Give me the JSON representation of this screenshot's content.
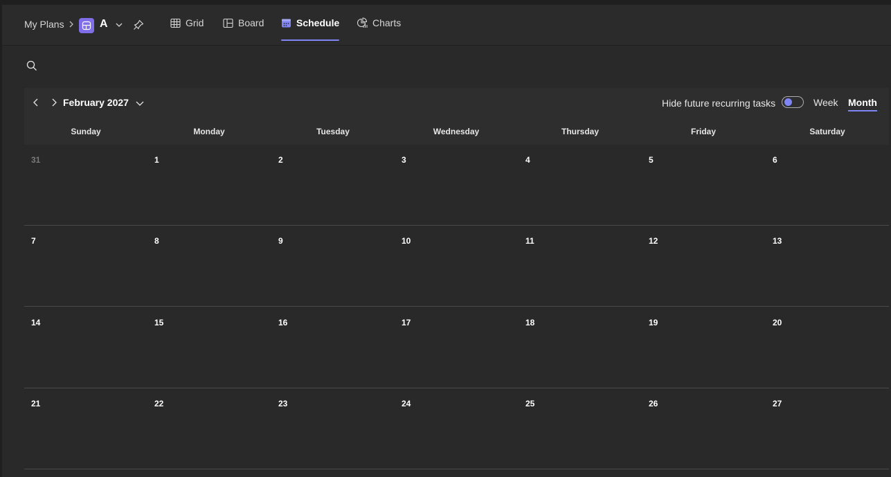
{
  "breadcrumb": {
    "root": "My Plans",
    "plan_name": "A"
  },
  "tabs": [
    {
      "label": "Grid",
      "icon": "grid-icon",
      "active": false
    },
    {
      "label": "Board",
      "icon": "board-icon",
      "active": false
    },
    {
      "label": "Schedule",
      "icon": "calendar-icon",
      "active": true
    },
    {
      "label": "Charts",
      "icon": "chart-icon",
      "active": false
    }
  ],
  "calendar": {
    "month_label": "February 2027",
    "hide_recurring_label": "Hide future recurring tasks",
    "hide_recurring_on": false,
    "views": {
      "week": "Week",
      "month": "Month",
      "active": "Month"
    },
    "weekdays": [
      "Sunday",
      "Monday",
      "Tuesday",
      "Wednesday",
      "Thursday",
      "Friday",
      "Saturday"
    ],
    "weeks": [
      [
        "31",
        "1",
        "2",
        "3",
        "4",
        "5",
        "6"
      ],
      [
        "7",
        "8",
        "9",
        "10",
        "11",
        "12",
        "13"
      ],
      [
        "14",
        "15",
        "16",
        "17",
        "18",
        "19",
        "20"
      ],
      [
        "21",
        "22",
        "23",
        "24",
        "25",
        "26",
        "27"
      ]
    ],
    "outside_month_days": [
      "31"
    ]
  },
  "colors": {
    "accent": "#7f85f5",
    "plan_tile": "#7f6ee8",
    "background": "#292929"
  }
}
